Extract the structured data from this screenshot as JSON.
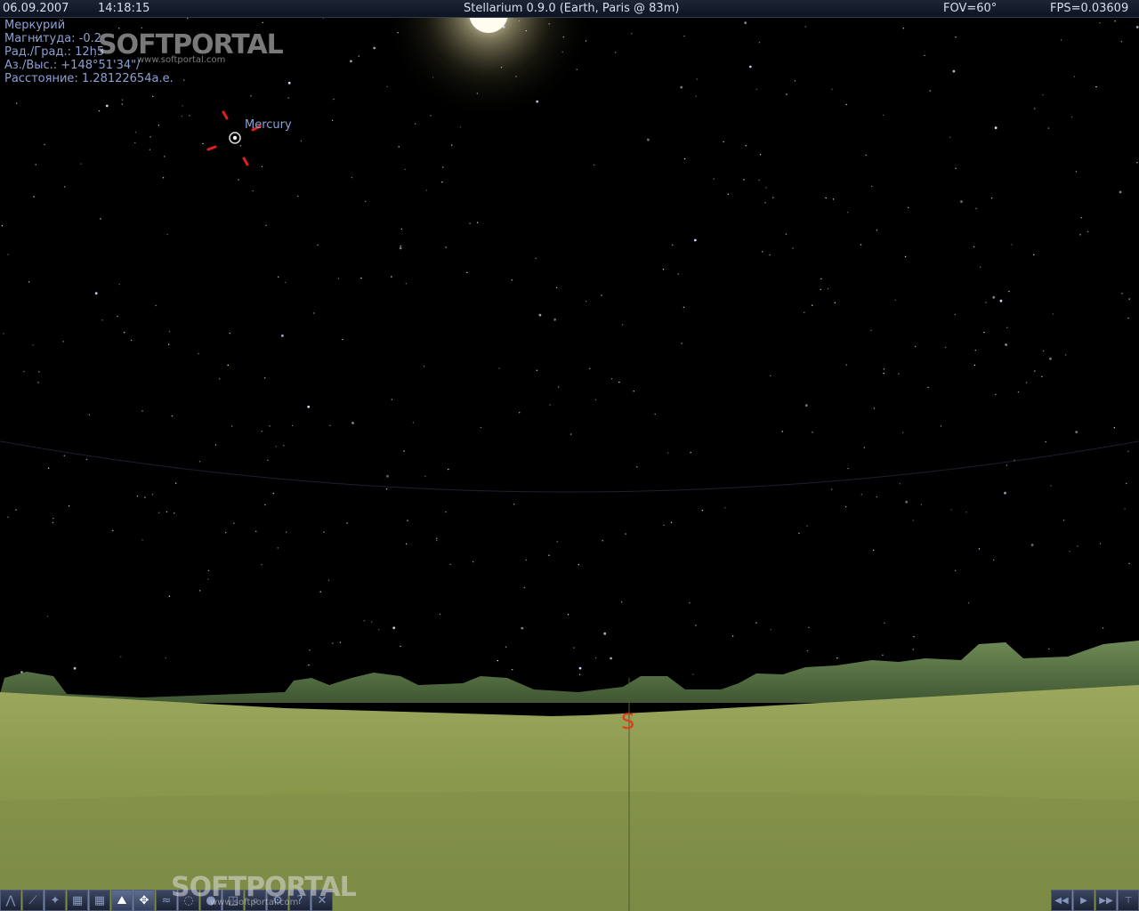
{
  "topbar": {
    "date": "06.09.2007",
    "time": "14:18:15",
    "title": "Stellarium 0.9.0 (Earth, Paris @ 83m)",
    "fov": "FOV=60°",
    "fps": "FPS=0.03609"
  },
  "object_info": {
    "name": "Меркурий",
    "magnitude": "Магнитуда: -0.2",
    "ra_dec": "Рад./Град.: 12h5",
    "az_alt": "Аз./Выс.: +148°51'34\"/",
    "distance": "Расстояние: 1.28122654а.е."
  },
  "selected_object_label": "Mercury",
  "cardinal_label": "S",
  "watermarks": [
    {
      "big": "SOFTPORTAL",
      "small": "www.softportal.com"
    },
    {
      "big": "SOFTPORTAL",
      "small": "www.softportal.com"
    }
  ],
  "toolbar": {
    "buttons": [
      {
        "name": "constellation-lines-icon",
        "glyph": "⋀"
      },
      {
        "name": "constellation-names-icon",
        "glyph": "⟋"
      },
      {
        "name": "constellation-art-icon",
        "glyph": "✦"
      },
      {
        "name": "azimuthal-grid-icon",
        "glyph": "▦"
      },
      {
        "name": "equatorial-grid-icon",
        "glyph": "▦"
      },
      {
        "name": "ground-icon",
        "glyph": "⛰"
      },
      {
        "name": "cardinal-points-icon",
        "glyph": "✥"
      },
      {
        "name": "atmosphere-icon",
        "glyph": "≈"
      },
      {
        "name": "nebulas-icon",
        "glyph": "◌"
      },
      {
        "name": "planets-labels-icon",
        "glyph": "●"
      },
      {
        "name": "mount-icon",
        "glyph": "◫"
      },
      {
        "name": "search-icon",
        "glyph": "⌕"
      },
      {
        "name": "config-icon",
        "glyph": "⚙"
      },
      {
        "name": "help-icon",
        "glyph": "?"
      },
      {
        "name": "quit-icon",
        "glyph": "✕"
      }
    ],
    "active": [
      "ground-icon",
      "cardinal-points-icon"
    ]
  },
  "timebar": {
    "buttons": [
      {
        "name": "rewind-icon",
        "glyph": "◀◀"
      },
      {
        "name": "play-icon",
        "glyph": "▶"
      },
      {
        "name": "fast-forward-icon",
        "glyph": "▶▶"
      },
      {
        "name": "now-icon",
        "glyph": "⊤"
      }
    ]
  },
  "colors": {
    "sky": "#000000",
    "ground": "#8a9a4e",
    "info_text": "#8ea0d2",
    "cardinal": "#e03c1c",
    "pointer": "#e0201c"
  }
}
